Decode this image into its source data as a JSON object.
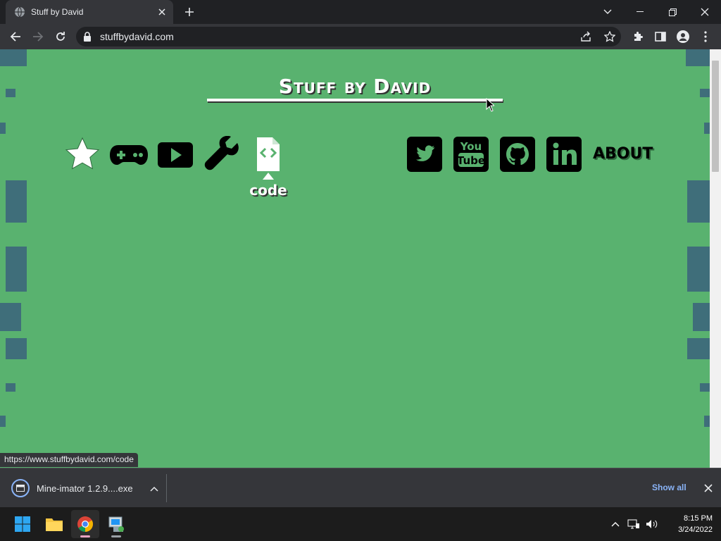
{
  "browser": {
    "tab_title": "Stuff by David",
    "url": "stuffbydavid.com",
    "status_url": "https://www.stuffbydavid.com/code"
  },
  "site": {
    "title": "Stuff by David",
    "code_label": "code",
    "about_label": "ABOUT",
    "background_color": "#59b26f",
    "nav_left": [
      "star-icon",
      "gamepad-icon",
      "video-icon",
      "wrench-icon",
      "code-file-icon"
    ],
    "nav_right": [
      "twitter-icon",
      "youtube-icon",
      "github-icon",
      "linkedin-icon"
    ],
    "youtube_text": [
      "You",
      "Tube"
    ]
  },
  "downloads": {
    "file": "Mine-imator 1.2.9....exe",
    "show_all": "Show all"
  },
  "taskbar": {
    "time": "8:15 PM",
    "date": "3/24/2022"
  }
}
